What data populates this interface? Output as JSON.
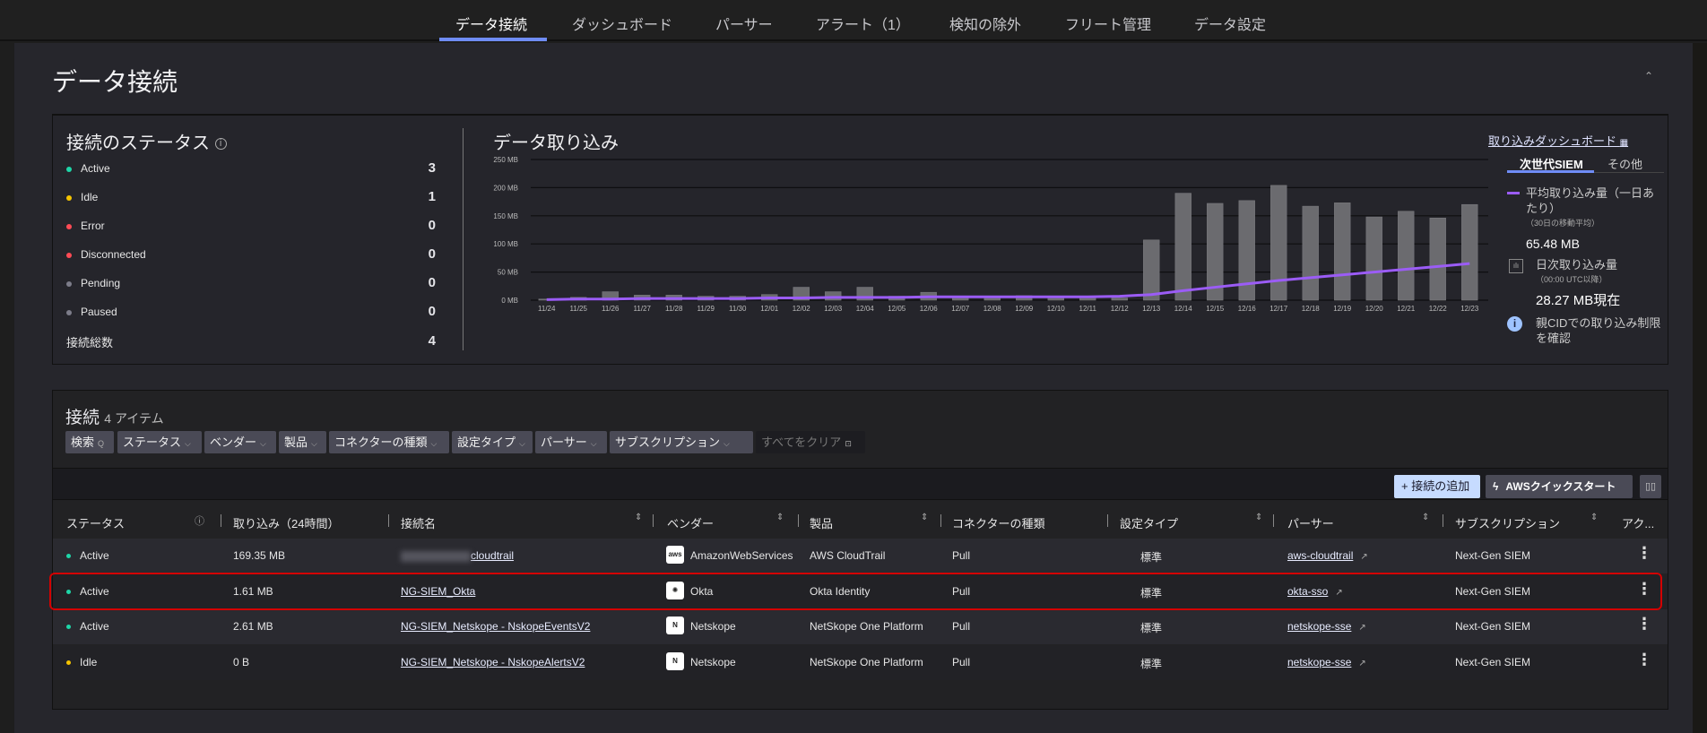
{
  "nav": {
    "tabs": [
      "データ接続",
      "ダッシュボード",
      "パーサー",
      "アラート（1）",
      "検知の除外",
      "フリート管理",
      "データ設定"
    ]
  },
  "page_title": "データ接続",
  "status": {
    "title": "接続のステータス",
    "items": [
      {
        "label": "Active",
        "count": "3",
        "color": "#1ed6a8"
      },
      {
        "label": "Idle",
        "count": "1",
        "color": "#f5c400"
      },
      {
        "label": "Error",
        "count": "0",
        "color": "#ff4b55"
      },
      {
        "label": "Disconnected",
        "count": "0",
        "color": "#ff4b55"
      },
      {
        "label": "Pending",
        "count": "0",
        "color": "#7d7d8a"
      },
      {
        "label": "Paused",
        "count": "0",
        "color": "#7d7d8a"
      }
    ],
    "total_label": "接続総数",
    "total": "4"
  },
  "ingest": {
    "title": "データ取り込み",
    "dashboard_link": "取り込みダッシュボード",
    "tabs": [
      "次世代SIEM",
      "その他"
    ],
    "avg_label": "平均取り込み量（一日あたり）",
    "avg_sub": "（30日の移動平均）",
    "avg_value": "65.48 MB",
    "daily_label": "日次取り込み量",
    "daily_sub": "（00:00 UTC以降）",
    "daily_value": "28.27 MB現在",
    "limit_link": "親CIDでの取り込み制限を確認"
  },
  "chart_data": {
    "type": "bar",
    "title": "データ取り込み",
    "ylabel": "",
    "xlabel": "",
    "ylim": [
      0,
      250
    ],
    "yticks": [
      "0 MB",
      "50 MB",
      "100 MB",
      "150 MB",
      "200 MB",
      "250 MB"
    ],
    "ytick_values": [
      0,
      50,
      100,
      150,
      200,
      250
    ],
    "categories": [
      "11/24",
      "11/25",
      "11/26",
      "11/27",
      "11/28",
      "11/29",
      "11/30",
      "12/01",
      "12/02",
      "12/03",
      "12/04",
      "12/05",
      "12/06",
      "12/07",
      "12/08",
      "12/09",
      "12/10",
      "12/11",
      "12/12",
      "12/13",
      "12/14",
      "12/15",
      "12/16",
      "12/17",
      "12/18",
      "12/19",
      "12/20",
      "12/21",
      "12/22",
      "12/23"
    ],
    "series": [
      {
        "name": "日次取り込み量",
        "type": "bar",
        "color": "#6b6b6f",
        "values": [
          2,
          5,
          15,
          9,
          9,
          7,
          7,
          10,
          23,
          15,
          23,
          7,
          14,
          6,
          7,
          8,
          7,
          5,
          4,
          107,
          190,
          172,
          177,
          204,
          167,
          173,
          148,
          158,
          146,
          170
        ]
      },
      {
        "name": "平均取り込み量",
        "type": "line",
        "color": "#9b5cf6",
        "values": [
          1,
          2,
          2,
          3,
          3,
          3,
          3,
          4,
          4,
          5,
          5,
          5,
          6,
          6,
          6,
          6,
          6,
          6,
          7,
          10,
          17,
          23,
          29,
          35,
          40,
          45,
          50,
          55,
          60,
          65
        ]
      }
    ],
    "grid": true
  },
  "connections": {
    "title": "接続",
    "count": "4 アイテム",
    "filters": [
      "検索",
      "ステータス",
      "ベンダー",
      "製品",
      "コネクターの種類",
      "設定タイプ",
      "パーサー",
      "サブスクリプション"
    ],
    "clear_all": "すべてをクリア",
    "add_button": "+ 接続の追加",
    "aws_button": "AWSクイックスタート",
    "columns": [
      "ステータス",
      "取り込み（24時間）",
      "接続名",
      "ベンダー",
      "製品",
      "コネクターの種類",
      "設定タイプ",
      "パーサー",
      "サブスクリプション",
      "アク..."
    ],
    "rows": [
      {
        "status": "Active",
        "color": "#1ed6a8",
        "ingest": "169.35 MB",
        "name": "cloudtrail",
        "vendor": "AmazonWebServices",
        "vicon": "aws",
        "product": "AWS CloudTrail",
        "connector": "Pull",
        "config": "標準",
        "parser": "aws-cloudtrail",
        "sub": "Next-Gen SIEM"
      },
      {
        "status": "Active",
        "color": "#1ed6a8",
        "ingest": "1.61 MB",
        "name": "NG-SIEM_Okta",
        "vendor": "Okta",
        "vicon": "✺",
        "product": "Okta Identity",
        "connector": "Pull",
        "config": "標準",
        "parser": "okta-sso",
        "sub": "Next-Gen SIEM"
      },
      {
        "status": "Active",
        "color": "#1ed6a8",
        "ingest": "2.61 MB",
        "name": "NG-SIEM_Netskope - NskopeEventsV2",
        "vendor": "Netskope",
        "vicon": "N",
        "product": "NetSkope One Platform",
        "connector": "Pull",
        "config": "標準",
        "parser": "netskope-sse",
        "sub": "Next-Gen SIEM"
      },
      {
        "status": "Idle",
        "color": "#f5c400",
        "ingest": "0 B",
        "name": "NG-SIEM_Netskope - NskopeAlertsV2",
        "vendor": "Netskope",
        "vicon": "N",
        "product": "NetSkope One Platform",
        "connector": "Pull",
        "config": "標準",
        "parser": "netskope-sse",
        "sub": "Next-Gen SIEM"
      }
    ]
  }
}
